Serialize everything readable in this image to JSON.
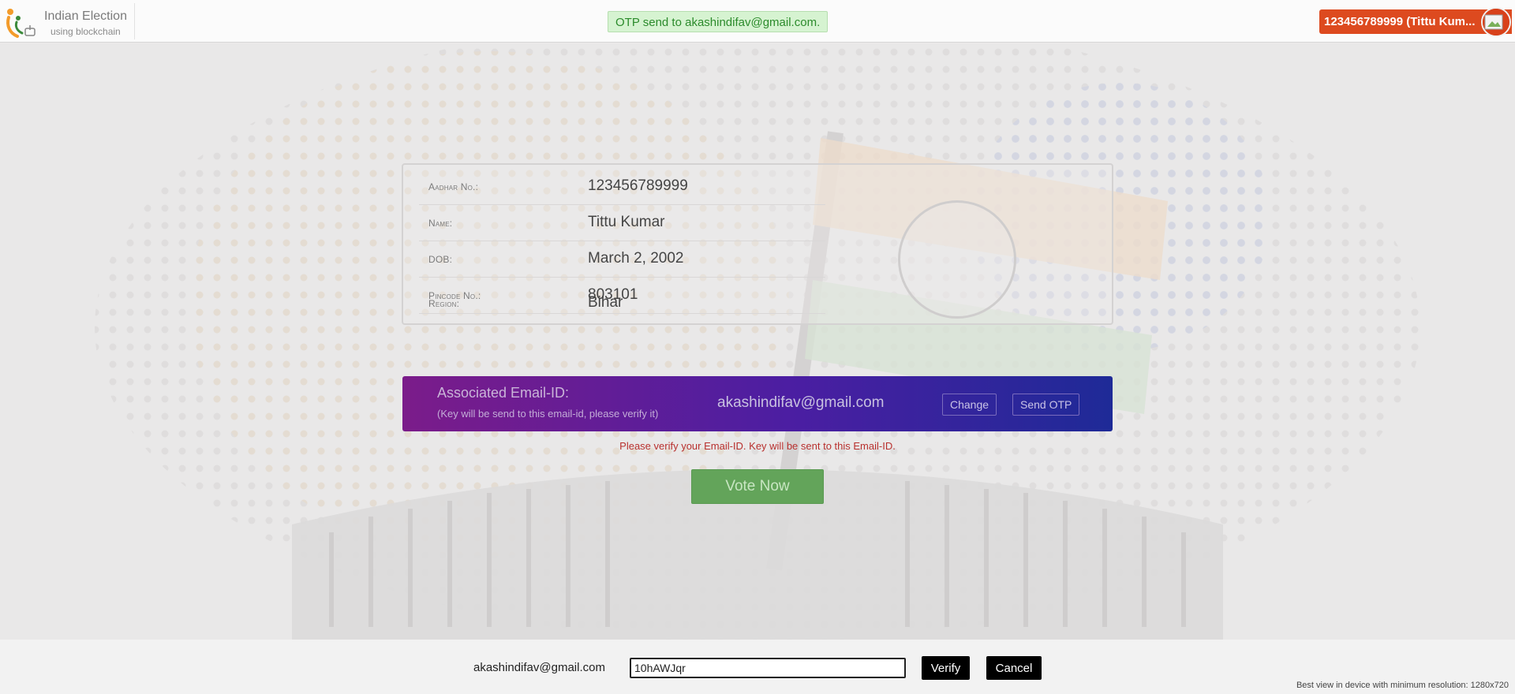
{
  "header": {
    "brand_title": "Indian Election",
    "brand_subtitle": "using blockchain",
    "toast": "OTP send to akashindifav@gmail.com.",
    "user_badge": "123456789999 (Tittu Kum...",
    "colors": {
      "badge": "#dd4a1f",
      "toast_bg": "#d6f3d1",
      "toast_text": "#2b8b2b"
    }
  },
  "details": {
    "rows": [
      {
        "label": "Aadhar No.:",
        "value": "123456789999"
      },
      {
        "label": "Name:",
        "value": "Tittu Kumar"
      },
      {
        "label": "DOB:",
        "value": "March 2, 2002"
      },
      {
        "label": "Pincode No.:",
        "value": "803101"
      },
      {
        "label": "Region:",
        "value": "Bihar"
      }
    ]
  },
  "email_band": {
    "heading": "Associated Email-ID:",
    "subtext": "(Key will be send to this email-id, please verify it)",
    "email": "akashindifav@gmail.com",
    "change_label": "Change",
    "send_otp_label": "Send OTP"
  },
  "warning": "Please verify your Email-ID. Key will be sent to this Email-ID.",
  "vote_label": "Vote Now",
  "verify_bar": {
    "email": "akashindifav@gmail.com",
    "otp_value": "10hAWJqr",
    "verify_label": "Verify",
    "cancel_label": "Cancel",
    "note": "Best view in device with minimum resolution: 1280x720"
  }
}
